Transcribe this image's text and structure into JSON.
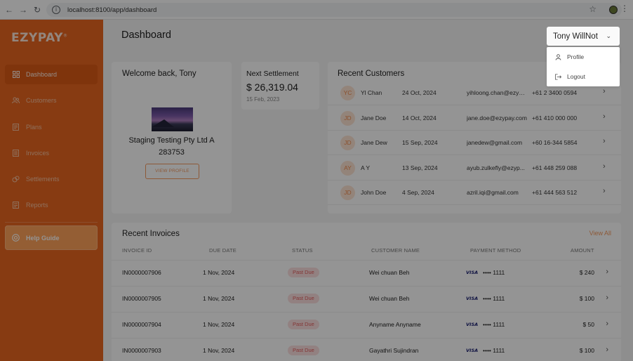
{
  "browser": {
    "url": "localhost:8100/app/dashboard",
    "back_icon": "arrow-left-icon",
    "forward_icon": "arrow-right-icon",
    "reload_icon": "reload-icon"
  },
  "brand": {
    "name": "EZYPAY",
    "mark": "®"
  },
  "colors": {
    "accent": "#e8661f",
    "help": "#ffa35a",
    "past_due": "#e25c5c"
  },
  "sidebar": {
    "items": [
      {
        "label": "Dashboard",
        "icon": "grid-icon",
        "active": true
      },
      {
        "label": "Customers",
        "icon": "users-icon"
      },
      {
        "label": "Plans",
        "icon": "document-icon"
      },
      {
        "label": "Invoices",
        "icon": "invoice-icon"
      },
      {
        "label": "Settlements",
        "icon": "coins-icon"
      },
      {
        "label": "Reports",
        "icon": "report-icon"
      }
    ],
    "help": {
      "label": "Help Guide",
      "icon": "lifebuoy-icon"
    }
  },
  "header": {
    "title": "Dashboard",
    "user": "Tony WillNot"
  },
  "user_menu": {
    "items": [
      {
        "label": "Profile",
        "icon": "person-icon"
      },
      {
        "label": "Logout",
        "icon": "logout-icon"
      }
    ]
  },
  "welcome": {
    "title": "Welcome back, Tony",
    "company_line1": "Staging Testing Pty Ltd A",
    "company_line2": "283753",
    "button": "VIEW PROFILE"
  },
  "settlement": {
    "label": "Next Settlement",
    "amount": "$ 26,319.04",
    "date": "15 Feb, 2023"
  },
  "recent_customers": {
    "title": "Recent Customers",
    "rows": [
      {
        "initials": "YC",
        "name": "Yl Chan",
        "date": "24 Oct, 2024",
        "email": "yihloong.chan@ezyp...",
        "phone": "+61 2 3400 0594"
      },
      {
        "initials": "JD",
        "name": "Jane Doe",
        "date": "14 Oct, 2024",
        "email": "jane.doe@ezypay.com",
        "phone": "+61 410 000 000"
      },
      {
        "initials": "JD",
        "name": "Jane Dew",
        "date": "15 Sep, 2024",
        "email": "janedew@gmail.com",
        "phone": "+60 16-344 5854"
      },
      {
        "initials": "AY",
        "name": "A Y",
        "date": "13 Sep, 2024",
        "email": "ayub.zulkefly@ezyp...",
        "phone": "+61 448 259 088"
      },
      {
        "initials": "JD",
        "name": "John Doe",
        "date": "4 Sep, 2024",
        "email": "azril.iqi@gmail.com",
        "phone": "+61 444 563 512"
      }
    ]
  },
  "recent_invoices": {
    "title": "Recent Invoices",
    "view_all": "View All",
    "columns": [
      "INVOICE ID",
      "DUE DATE",
      "STATUS",
      "CUSTOMER NAME",
      "PAYMENT METHOD",
      "AMOUNT"
    ],
    "rows": [
      {
        "id": "IN0000007906",
        "due": "1 Nov, 2024",
        "status": "Past Due",
        "customer": "Wei chuan Beh",
        "brand": "VISA",
        "card": "•••• 1111",
        "amount": "$ 240"
      },
      {
        "id": "IN0000007905",
        "due": "1 Nov, 2024",
        "status": "Past Due",
        "customer": "Wei chuan Beh",
        "brand": "VISA",
        "card": "•••• 1111",
        "amount": "$ 100"
      },
      {
        "id": "IN0000007904",
        "due": "1 Nov, 2024",
        "status": "Past Due",
        "customer": "Anyname Anyname",
        "brand": "VISA",
        "card": "•••• 1111",
        "amount": "$ 50"
      },
      {
        "id": "IN0000007903",
        "due": "1 Nov, 2024",
        "status": "Past Due",
        "customer": "Gayathri Sujindran",
        "brand": "VISA",
        "card": "•••• 1111",
        "amount": "$ 100"
      }
    ]
  }
}
